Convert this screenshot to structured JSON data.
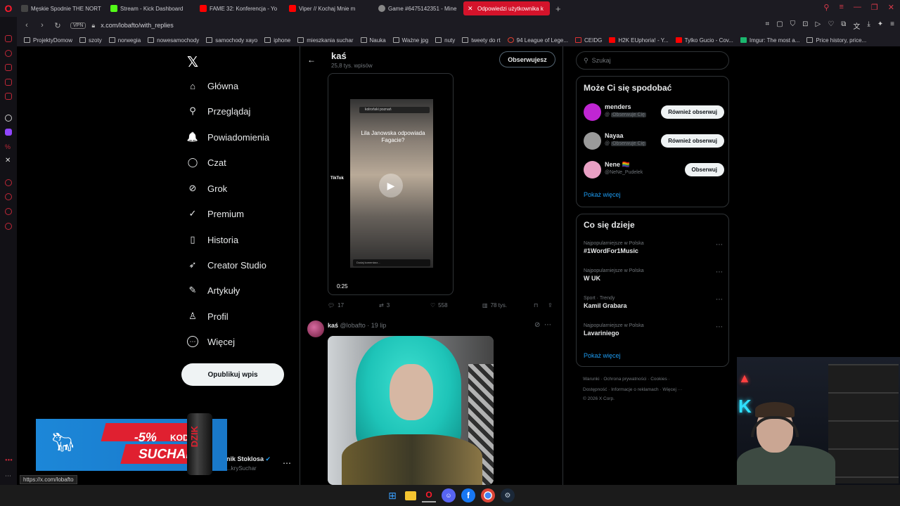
{
  "browser": {
    "tabs": [
      {
        "label": "Męskie Spodnie THE NORT",
        "color": "#333"
      },
      {
        "label": "Stream - Kick Dashboard",
        "color": "#53fc18"
      },
      {
        "label": "FAME 32: Konferencja - Yo",
        "color": "#ff0000"
      },
      {
        "label": "Viper // Kochaj Mnie m",
        "color": "#ff0000"
      },
      {
        "label": "Game #6475142351 - Mine",
        "color": "#888"
      },
      {
        "label": "Odpowiedzi użytkownika k",
        "color": "#fff"
      }
    ],
    "new_tab": "+",
    "vpn": "VPN",
    "url": "x.com/lobafto/with_replies",
    "bookmarks": [
      "ProjektyDomow",
      "szoty",
      "norwegia",
      "nowesamochody",
      "samochody xayo",
      "iphone",
      "mieszkania suchar",
      "Nauka",
      "Ważne jpg",
      "nuty",
      "tweety do rt",
      "94 League of Lege...",
      "CEIDG",
      "H2K EUphoria! - Y...",
      "Tylko Gucio - Cov...",
      "Imgur: The most a...",
      "Price history, price..."
    ],
    "status_url": "https://x.com/lobafto"
  },
  "nav": {
    "logo": "𝕏",
    "items": [
      {
        "label": "Główna",
        "icon": "⌂"
      },
      {
        "label": "Przeglądaj",
        "icon": "⚲"
      },
      {
        "label": "Powiadomienia",
        "icon": "🔔"
      },
      {
        "label": "Czat",
        "icon": "◯"
      },
      {
        "label": "Grok",
        "icon": "⊘"
      },
      {
        "label": "Premium",
        "icon": "✓"
      },
      {
        "label": "Historia",
        "icon": "▯"
      },
      {
        "label": "Creator Studio",
        "icon": "➶"
      },
      {
        "label": "Artykuły",
        "icon": "✎"
      },
      {
        "label": "Profil",
        "icon": "♙"
      },
      {
        "label": "Więcej",
        "icon": "⋯"
      }
    ],
    "post_button": "Opublikuj wpis",
    "account_name": "nik Stoklosa",
    "account_handle": "...krySuchar",
    "more": "⋯"
  },
  "ad": {
    "discount": "-5%",
    "kod": "KOD",
    "code": "SUCHAR",
    "brand": "DZIK"
  },
  "profile": {
    "back": "←",
    "name": "kaś",
    "posts_count": "25,8 tys. wpisów",
    "follow_label": "Obserwujesz"
  },
  "tweet1": {
    "video_title": "Lila Janowska odpowiada Fagacie?",
    "video_search": "kolroński poznań",
    "tiktok_label": "TikTok",
    "comment_placeholder": "Dodaj komentarz...",
    "time": "0:25",
    "replies": "17",
    "retweets": "3",
    "likes": "558",
    "views": "78 tys."
  },
  "tweet2": {
    "name": "kaś",
    "handle": "@lobafto",
    "date": "19 lip"
  },
  "sidebar": {
    "search_placeholder": "Szukaj",
    "suggest_title": "Może Ci się spodobać",
    "suggestions": [
      {
        "name": "menders",
        "handle": "@",
        "follows_you": "Obserwuje Cię",
        "button": "Również obserwuj",
        "color": "#c026d3"
      },
      {
        "name": "Nayaa",
        "handle": "@",
        "follows_you": "Obserwuje Cię",
        "button": "Również obserwuj",
        "color": "#888"
      },
      {
        "name": "Nene 🏳️‍🌈",
        "handle": "@NeNe_Pudelek",
        "follows_you": "",
        "button": "Obserwuj",
        "color": "#e9a0c4"
      }
    ],
    "show_more": "Pokaż więcej",
    "trends_title": "Co się dzieje",
    "trends": [
      {
        "category": "Najpopularniejsze w Polska",
        "topic": "#1WordFor1Music"
      },
      {
        "category": "Najpopularniejsze w Polska",
        "topic": "W UK"
      },
      {
        "category": "Sport · Trendy",
        "topic": "Kamil Grabara"
      },
      {
        "category": "Najpopularniejsze w Polska",
        "topic": "Lavariniego"
      }
    ],
    "trends_more": "Pokaż więcej",
    "footer_line1": "Warunki · Ochrona prywatności · Cookies ·",
    "footer_line2": "Dostępność · Informacje o reklamach · Więcej ···",
    "footer_line3": "© 2026 X Corp."
  }
}
